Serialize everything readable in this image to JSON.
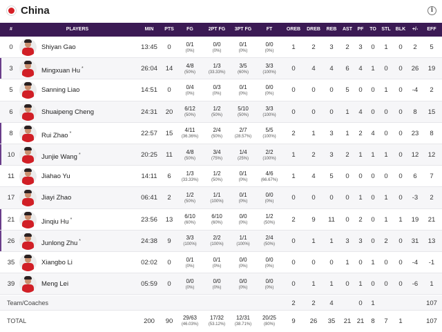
{
  "team": {
    "name": "China"
  },
  "columns": {
    "num": "#",
    "players": "PLAYERS",
    "min": "MIN",
    "pts": "PTS",
    "fg": "FG",
    "fg2": "2PT FG",
    "fg3": "3PT FG",
    "ft": "FT",
    "oreb": "OREB",
    "dreb": "DREB",
    "reb": "REB",
    "ast": "AST",
    "pf": "PF",
    "to": "TO",
    "stl": "STL",
    "blk": "BLK",
    "pm": "+/-",
    "eff": "EFF"
  },
  "players": [
    {
      "num": "0",
      "name": "Shiyan Gao",
      "starter": false,
      "min": "13:45",
      "pts": "0",
      "fg": "0/1",
      "fg_pct": "(0%)",
      "fg2": "0/0",
      "fg2_pct": "(0%)",
      "fg3": "0/1",
      "fg3_pct": "(0%)",
      "ft": "0/0",
      "ft_pct": "(0%)",
      "oreb": "1",
      "dreb": "2",
      "reb": "3",
      "ast": "2",
      "pf": "3",
      "to": "0",
      "stl": "1",
      "blk": "0",
      "pm": "2",
      "eff": "5"
    },
    {
      "num": "3",
      "name": "Mingxuan Hu",
      "starter": true,
      "min": "26:04",
      "pts": "14",
      "fg": "4/8",
      "fg_pct": "(50%)",
      "fg2": "1/3",
      "fg2_pct": "(33.33%)",
      "fg3": "3/5",
      "fg3_pct": "(60%)",
      "ft": "3/3",
      "ft_pct": "(100%)",
      "oreb": "0",
      "dreb": "4",
      "reb": "4",
      "ast": "6",
      "pf": "4",
      "to": "1",
      "stl": "0",
      "blk": "0",
      "pm": "26",
      "eff": "19"
    },
    {
      "num": "5",
      "name": "Sanning Liao",
      "starter": false,
      "min": "14:51",
      "pts": "0",
      "fg": "0/4",
      "fg_pct": "(0%)",
      "fg2": "0/3",
      "fg2_pct": "(0%)",
      "fg3": "0/1",
      "fg3_pct": "(0%)",
      "ft": "0/0",
      "ft_pct": "(0%)",
      "oreb": "0",
      "dreb": "0",
      "reb": "0",
      "ast": "5",
      "pf": "0",
      "to": "0",
      "stl": "1",
      "blk": "0",
      "pm": "-4",
      "eff": "2"
    },
    {
      "num": "6",
      "name": "Shuaipeng Cheng",
      "starter": false,
      "min": "24:31",
      "pts": "20",
      "fg": "6/12",
      "fg_pct": "(50%)",
      "fg2": "1/2",
      "fg2_pct": "(50%)",
      "fg3": "5/10",
      "fg3_pct": "(50%)",
      "ft": "3/3",
      "ft_pct": "(100%)",
      "oreb": "0",
      "dreb": "0",
      "reb": "0",
      "ast": "1",
      "pf": "4",
      "to": "0",
      "stl": "0",
      "blk": "0",
      "pm": "8",
      "eff": "15"
    },
    {
      "num": "8",
      "name": "Rui Zhao",
      "starter": true,
      "min": "22:57",
      "pts": "15",
      "fg": "4/11",
      "fg_pct": "(36.36%)",
      "fg2": "2/4",
      "fg2_pct": "(50%)",
      "fg3": "2/7",
      "fg3_pct": "(28.57%)",
      "ft": "5/5",
      "ft_pct": "(100%)",
      "oreb": "2",
      "dreb": "1",
      "reb": "3",
      "ast": "1",
      "pf": "2",
      "to": "4",
      "stl": "0",
      "blk": "0",
      "pm": "23",
      "eff": "8"
    },
    {
      "num": "10",
      "name": "Junjie Wang",
      "starter": true,
      "min": "20:25",
      "pts": "11",
      "fg": "4/8",
      "fg_pct": "(50%)",
      "fg2": "3/4",
      "fg2_pct": "(75%)",
      "fg3": "1/4",
      "fg3_pct": "(25%)",
      "ft": "2/2",
      "ft_pct": "(100%)",
      "oreb": "1",
      "dreb": "2",
      "reb": "3",
      "ast": "2",
      "pf": "1",
      "to": "1",
      "stl": "1",
      "blk": "0",
      "pm": "12",
      "eff": "12"
    },
    {
      "num": "11",
      "name": "Jiahao Yu",
      "starter": false,
      "min": "14:11",
      "pts": "6",
      "fg": "1/3",
      "fg_pct": "(33.33%)",
      "fg2": "1/2",
      "fg2_pct": "(50%)",
      "fg3": "0/1",
      "fg3_pct": "(0%)",
      "ft": "4/6",
      "ft_pct": "(66.67%)",
      "oreb": "1",
      "dreb": "4",
      "reb": "5",
      "ast": "0",
      "pf": "0",
      "to": "0",
      "stl": "0",
      "blk": "0",
      "pm": "6",
      "eff": "7"
    },
    {
      "num": "17",
      "name": "Jiayi Zhao",
      "starter": false,
      "min": "06:41",
      "pts": "2",
      "fg": "1/2",
      "fg_pct": "(50%)",
      "fg2": "1/1",
      "fg2_pct": "(100%)",
      "fg3": "0/1",
      "fg3_pct": "(0%)",
      "ft": "0/0",
      "ft_pct": "(0%)",
      "oreb": "0",
      "dreb": "0",
      "reb": "0",
      "ast": "0",
      "pf": "1",
      "to": "0",
      "stl": "1",
      "blk": "0",
      "pm": "-3",
      "eff": "2"
    },
    {
      "num": "21",
      "name": "Jinqiu Hu",
      "starter": true,
      "min": "23:56",
      "pts": "13",
      "fg": "6/10",
      "fg_pct": "(60%)",
      "fg2": "6/10",
      "fg2_pct": "(60%)",
      "fg3": "0/0",
      "fg3_pct": "(0%)",
      "ft": "1/2",
      "ft_pct": "(50%)",
      "oreb": "2",
      "dreb": "9",
      "reb": "11",
      "ast": "0",
      "pf": "2",
      "to": "0",
      "stl": "1",
      "blk": "1",
      "pm": "19",
      "eff": "21"
    },
    {
      "num": "26",
      "name": "Junlong Zhu",
      "starter": true,
      "min": "24:38",
      "pts": "9",
      "fg": "3/3",
      "fg_pct": "(100%)",
      "fg2": "2/2",
      "fg2_pct": "(100%)",
      "fg3": "1/1",
      "fg3_pct": "(100%)",
      "ft": "2/4",
      "ft_pct": "(50%)",
      "oreb": "0",
      "dreb": "1",
      "reb": "1",
      "ast": "3",
      "pf": "3",
      "to": "0",
      "stl": "2",
      "blk": "0",
      "pm": "31",
      "eff": "13"
    },
    {
      "num": "35",
      "name": "Xiangbo Li",
      "starter": false,
      "min": "02:02",
      "pts": "0",
      "fg": "0/1",
      "fg_pct": "(0%)",
      "fg2": "0/1",
      "fg2_pct": "(0%)",
      "fg3": "0/0",
      "fg3_pct": "(0%)",
      "ft": "0/0",
      "ft_pct": "(0%)",
      "oreb": "0",
      "dreb": "0",
      "reb": "0",
      "ast": "1",
      "pf": "0",
      "to": "1",
      "stl": "0",
      "blk": "0",
      "pm": "-4",
      "eff": "-1"
    },
    {
      "num": "39",
      "name": "Meng Lei",
      "starter": false,
      "min": "05:59",
      "pts": "0",
      "fg": "0/0",
      "fg_pct": "(0%)",
      "fg2": "0/0",
      "fg2_pct": "(0%)",
      "fg3": "0/0",
      "fg3_pct": "(0%)",
      "ft": "0/0",
      "ft_pct": "(0%)",
      "oreb": "0",
      "dreb": "1",
      "reb": "1",
      "ast": "0",
      "pf": "1",
      "to": "0",
      "stl": "0",
      "blk": "0",
      "pm": "-6",
      "eff": "1"
    }
  ],
  "coaches": {
    "label": "Team/Coaches",
    "oreb": "2",
    "dreb": "2",
    "reb": "4",
    "pf": "0",
    "to": "1",
    "eff": "107"
  },
  "totals": {
    "label": "TOTAL",
    "min": "200",
    "pts": "90",
    "fg": "29/63",
    "fg_pct": "(46.03%)",
    "fg2": "17/32",
    "fg2_pct": "(53.12%)",
    "fg3": "12/31",
    "fg3_pct": "(38.71%)",
    "ft": "20/25",
    "ft_pct": "(80%)",
    "oreb": "9",
    "dreb": "26",
    "reb": "35",
    "ast": "21",
    "pf": "21",
    "to": "8",
    "stl": "7",
    "blk": "1",
    "eff": "107"
  },
  "colors": {
    "header_bg": "#3b1a54",
    "flag_red": "#d61f26",
    "jersey_red": "#d11f26"
  }
}
